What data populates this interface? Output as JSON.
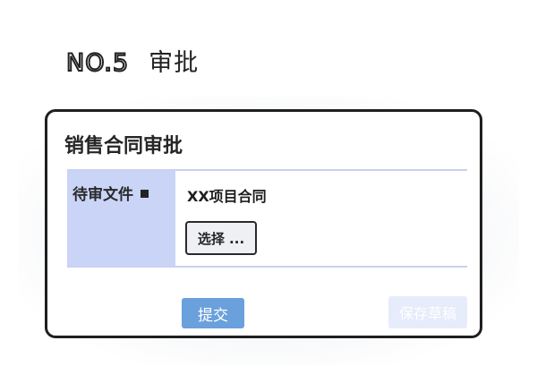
{
  "step": {
    "number": "NO.5",
    "title": "审批"
  },
  "card": {
    "title": "销售合同审批",
    "field": {
      "label": "待审文件",
      "file_name": "XX项目合同",
      "choose_label": "选择 ..."
    },
    "actions": {
      "submit_label": "提交",
      "save_draft_label": "保存草稿"
    }
  },
  "colors": {
    "label_bg": "#c9d4f7",
    "submit_bg": "#6aa0dc",
    "draft_bg": "#e6ecfa",
    "border": "#1f1f1f"
  }
}
